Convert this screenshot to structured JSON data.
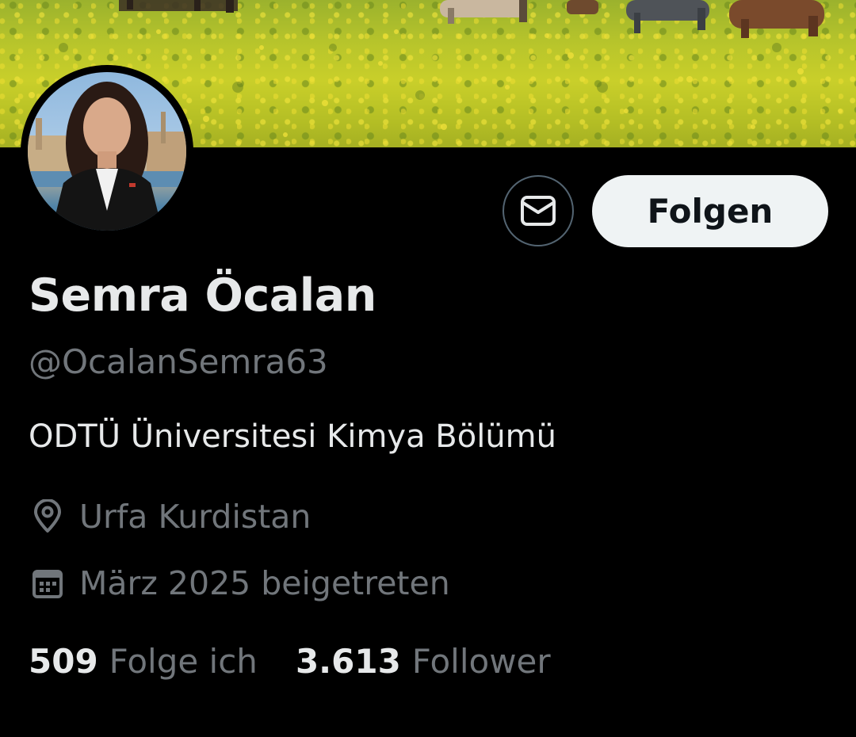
{
  "profile": {
    "display_name": "Semra Öcalan",
    "handle": "@OcalanSemra63",
    "bio": "ODTÜ Üniversitesi Kimya Bölümü",
    "location": "Urfa Kurdistan",
    "joined": "März 2025 beigetreten"
  },
  "actions": {
    "message_icon": "mail-icon",
    "follow_label": "Folgen"
  },
  "stats": {
    "following_count": "509",
    "following_label": "Folge ich",
    "followers_count": "3.613",
    "followers_label": "Follower"
  },
  "icons": {
    "location": "location-pin-icon",
    "calendar": "calendar-icon"
  },
  "colors": {
    "background": "#000000",
    "primary_text": "#e7e9ea",
    "secondary_text": "#71767b",
    "follow_button_bg": "#eff3f4",
    "follow_button_text": "#0f1419",
    "outline": "#536471"
  }
}
